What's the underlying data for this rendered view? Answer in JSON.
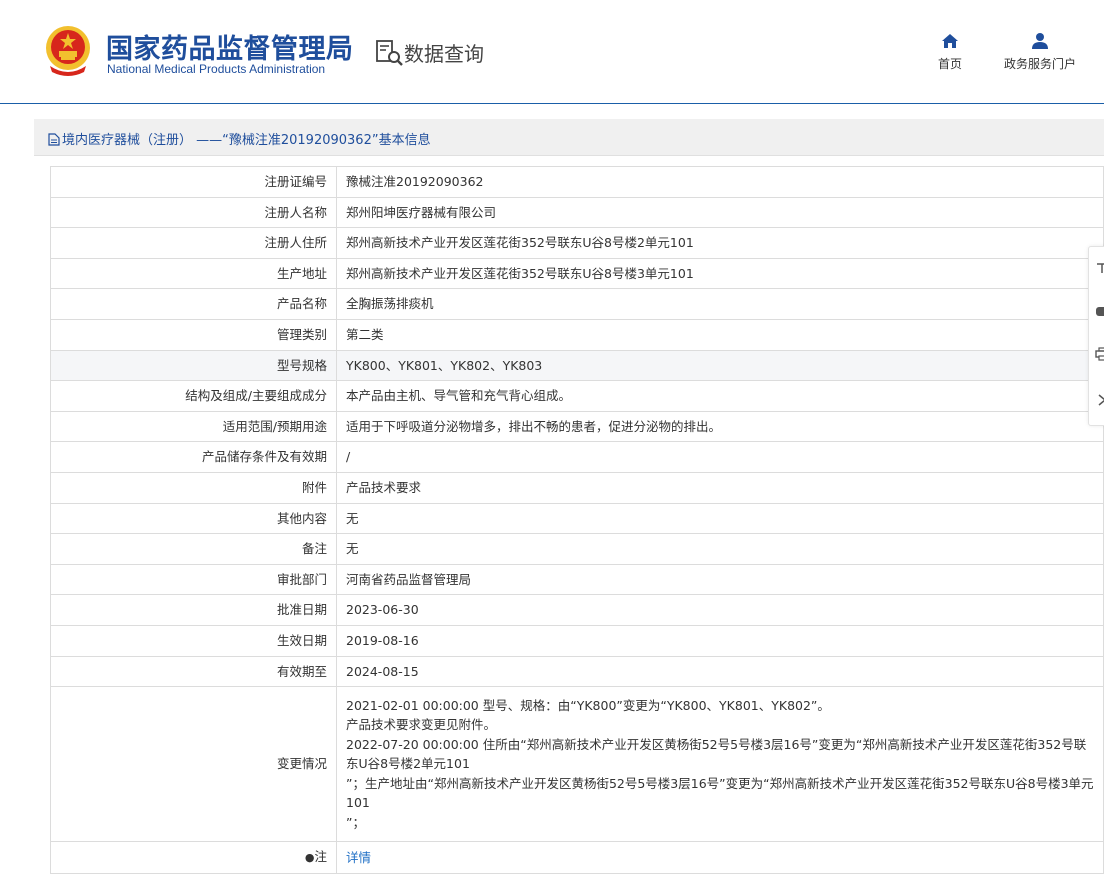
{
  "header": {
    "org_name_cn": "国家药品监督管理局",
    "org_name_en": "National Medical Products Administration",
    "query_title": "数据查询",
    "nav": [
      {
        "label": "首页",
        "icon": "home-icon"
      },
      {
        "label": "政务服务门户",
        "icon": "user-icon"
      }
    ],
    "colors": {
      "brand": "#1f4e9c",
      "accent": "#1a5fa8",
      "emblem_red": "#d7261c",
      "emblem_gold": "#f2c02e"
    }
  },
  "section": {
    "title": "境内医疗器械（注册） ——“豫械注准20192090362”基本信息"
  },
  "table": {
    "rows": [
      {
        "label": "注册证编号",
        "value": "豫械注准20192090362"
      },
      {
        "label": "注册人名称",
        "value": "郑州阳坤医疗器械有限公司"
      },
      {
        "label": "注册人住所",
        "value": "郑州高新技术产业开发区莲花街352号联东U谷8号楼2单元101"
      },
      {
        "label": "生产地址",
        "value": "郑州高新技术产业开发区莲花街352号联东U谷8号楼3单元101"
      },
      {
        "label": "产品名称",
        "value": "全胸振荡排痰机"
      },
      {
        "label": "管理类别",
        "value": "第二类"
      },
      {
        "label": "型号规格",
        "value": "YK800、YK801、YK802、YK803"
      },
      {
        "label": "结构及组成/主要组成成分",
        "value": "本产品由主机、导气管和充气背心组成。"
      },
      {
        "label": "适用范围/预期用途",
        "value": "适用于下呼吸道分泌物增多，排出不畅的患者，促进分泌物的排出。"
      },
      {
        "label": "产品储存条件及有效期",
        "value": "/"
      },
      {
        "label": "附件",
        "value": "产品技术要求"
      },
      {
        "label": "其他内容",
        "value": "无"
      },
      {
        "label": "备注",
        "value": "无"
      },
      {
        "label": "审批部门",
        "value": "河南省药品监督管理局"
      },
      {
        "label": "批准日期",
        "value": "2023-06-30"
      },
      {
        "label": "生效日期",
        "value": "2019-08-16"
      },
      {
        "label": "有效期至",
        "value": "2024-08-15"
      }
    ],
    "change": {
      "label": "变更情况",
      "lines": [
        "2021-02-01 00:00:00 型号、规格：由“YK800”变更为“YK800、YK801、YK802”。",
        "产品技术要求变更见附件。",
        "2022-07-20 00:00:00 住所由“郑州高新技术产业开发区黄杨街52号5号楼3层16号”变更为“郑州高新技术产业开发区莲花街352号联东U谷8号楼2单元101",
        "”；生产地址由“郑州高新技术产业开发区黄杨街52号5号楼3层16号”变更为“郑州高新技术产业开发区莲花街352号联东U谷8号楼3单元101",
        "”；"
      ]
    },
    "note": {
      "label": "注",
      "link_text": "详情"
    }
  },
  "side_tools": [
    {
      "icon": "expand-icon"
    },
    {
      "icon": "chat-icon"
    },
    {
      "icon": "print-icon"
    },
    {
      "icon": "chevron-right-icon"
    }
  ]
}
